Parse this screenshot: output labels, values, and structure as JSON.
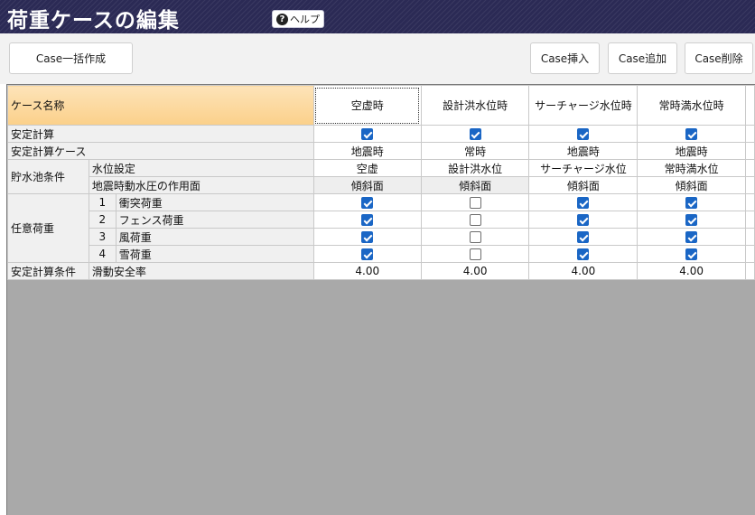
{
  "window": {
    "title": "荷重ケースの編集",
    "help_label": "ヘルプ"
  },
  "toolbar": {
    "bulk_create": "Case一括作成",
    "insert": "Case挿入",
    "add": "Case追加",
    "delete": "Case削除"
  },
  "grid": {
    "header_label": "ケース名称",
    "cases": [
      "空虚時",
      "設計洪水位時",
      "サーチャージ水位時",
      "常時満水位時"
    ],
    "rows": {
      "stability_calc": {
        "label": "安定計算",
        "values": [
          true,
          true,
          true,
          true
        ]
      },
      "stability_case": {
        "label": "安定計算ケース",
        "values": [
          "地震時",
          "常時",
          "地震時",
          "地震時"
        ]
      },
      "reservoir": {
        "label": "貯水池条件",
        "water_level": {
          "label": "水位設定",
          "values": [
            "空虚",
            "設計洪水位",
            "サーチャージ水位",
            "常時満水位"
          ]
        },
        "seismic_face": {
          "label": "地震時動水圧の作用面",
          "values": [
            "傾斜面",
            "傾斜面",
            "傾斜面",
            "傾斜面"
          ]
        }
      },
      "optional_loads": {
        "label": "任意荷重",
        "items": [
          {
            "no": "1",
            "label": "衝突荷重",
            "values": [
              true,
              false,
              true,
              true
            ]
          },
          {
            "no": "2",
            "label": "フェンス荷重",
            "values": [
              true,
              false,
              true,
              true
            ]
          },
          {
            "no": "3",
            "label": "風荷重",
            "values": [
              true,
              false,
              true,
              true
            ]
          },
          {
            "no": "4",
            "label": "雪荷重",
            "values": [
              true,
              false,
              true,
              true
            ]
          }
        ]
      },
      "stability_conditions": {
        "label": "安定計算条件",
        "sliding": {
          "label": "滑動安全率",
          "values": [
            "4.00",
            "4.00",
            "4.00",
            "4.00"
          ]
        }
      }
    }
  }
}
